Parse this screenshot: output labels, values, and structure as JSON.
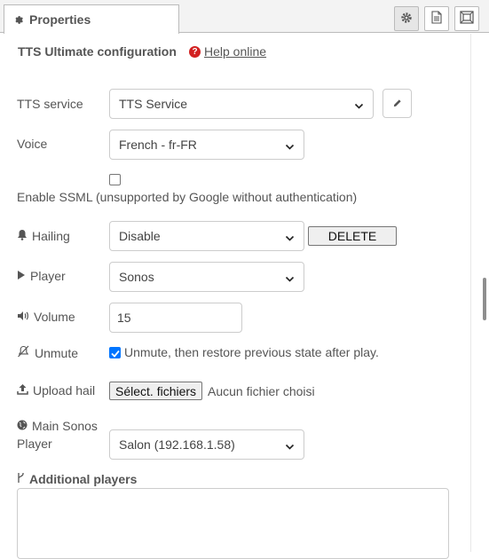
{
  "tab": {
    "title": "Properties"
  },
  "toolbar": {
    "settings_icon": "gear-icon",
    "description_icon": "document-icon",
    "appearance_icon": "frame-icon"
  },
  "header": {
    "title": "TTS Ultimate configuration",
    "help_label": "Help online"
  },
  "fields": {
    "tts_service": {
      "label": "TTS service",
      "value": "TTS Service"
    },
    "voice": {
      "label": "Voice",
      "value": "French - fr-FR"
    },
    "ssml": {
      "label": "Enable SSML (unsupported by Google without authentication)",
      "checked": false
    },
    "hailing": {
      "label": "Hailing",
      "value": "Disable",
      "delete_label": "DELETE"
    },
    "player": {
      "label": "Player",
      "value": "Sonos"
    },
    "volume": {
      "label": "Volume",
      "value": "15"
    },
    "unmute": {
      "label": "Unmute",
      "checkbox_label": "Unmute, then restore previous state after play.",
      "checked": true
    },
    "upload_hail": {
      "label": "Upload hail",
      "button_label": "Sélect. fichiers",
      "status": "Aucun fichier choisi"
    },
    "main_sonos_player": {
      "label_line1": "Main Sonos",
      "label_line2": "Player",
      "value": "Salon (192.168.1.58)"
    },
    "additional_players": {
      "label": "Additional players"
    }
  },
  "colors": {
    "help_icon": "#d22121",
    "checkbox_checked": "#0075ff"
  }
}
